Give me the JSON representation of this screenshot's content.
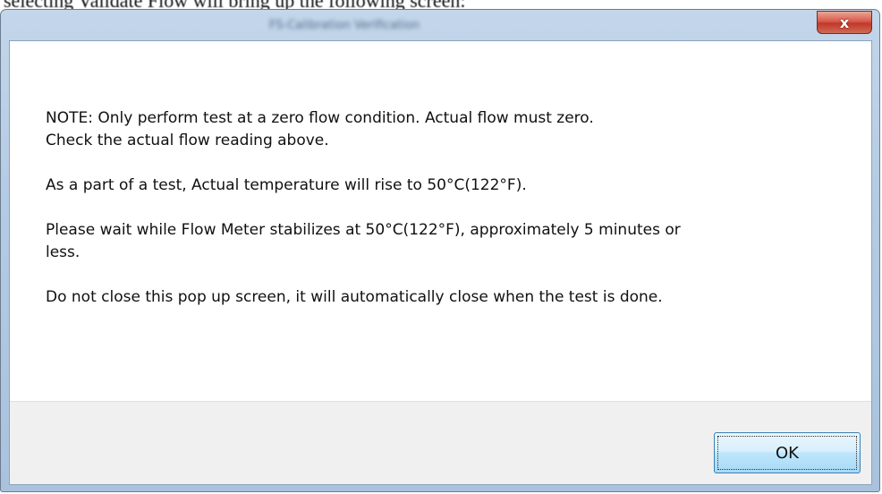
{
  "caption": {
    "text": "selecting Validate Flow will bring up the following screen:"
  },
  "dialog": {
    "title": "FS-Calibration Verification",
    "close_glyph": "x",
    "message": {
      "line1": "NOTE: Only perform test at a zero flow condition. Actual flow must zero.",
      "line2": "Check the actual flow reading above.",
      "line3": "As a part of a test, Actual temperature will rise to 50°C(122°F).",
      "line4": "Please wait while Flow Meter stabilizes at 50°C(122°F), approximately 5 minutes or",
      "line5": "less.",
      "line6": "Do not close this pop up screen, it will automatically close when the test is done."
    },
    "ok_label": "OK"
  },
  "colors": {
    "frame": "#b4cbe3",
    "close_button": "#c0392b",
    "footer": "#f0f0f0",
    "ok_button": "#bee6fd"
  }
}
